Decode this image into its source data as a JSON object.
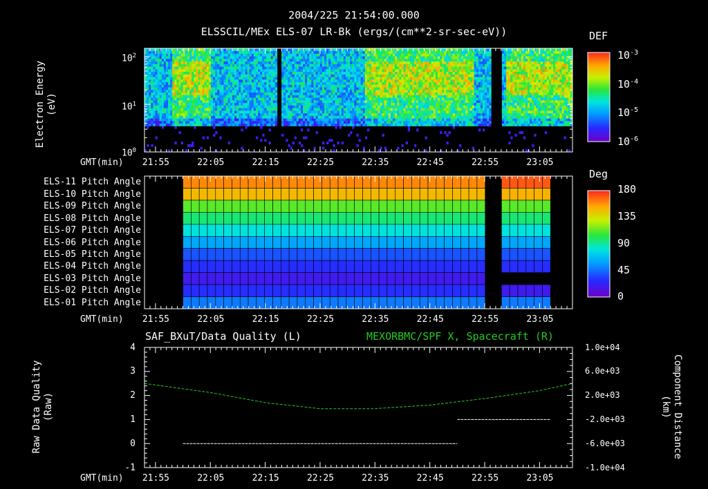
{
  "header": {
    "title": "2004/225 21:54:00.000",
    "subtitle": "ELSSCIL/MEx ELS-07 LR-Bk  (ergs/(cm**2-sr-sec-eV))"
  },
  "x_axis": {
    "label": "GMT(min)",
    "ticks": [
      "21:55",
      "22:05",
      "22:15",
      "22:25",
      "22:35",
      "22:45",
      "22:55",
      "23:05"
    ]
  },
  "panel1": {
    "ylabel_line1": "Electron Energy",
    "ylabel_line2": "(eV)",
    "yticks": [
      {
        "base": "10",
        "exp": "2"
      },
      {
        "base": "10",
        "exp": "1"
      },
      {
        "base": "10",
        "exp": "0"
      }
    ],
    "colorbar_title": "DEF",
    "colorbar_ticks": [
      {
        "base": "10",
        "exp": "-3"
      },
      {
        "base": "10",
        "exp": "-4"
      },
      {
        "base": "10",
        "exp": "-5"
      },
      {
        "base": "10",
        "exp": "-6"
      }
    ]
  },
  "panel2": {
    "rows": [
      "ELS-11 Pitch Angle",
      "ELS-10 Pitch Angle",
      "ELS-09 Pitch Angle",
      "ELS-08 Pitch Angle",
      "ELS-07 Pitch Angle",
      "ELS-06 Pitch Angle",
      "ELS-05 Pitch Angle",
      "ELS-04 Pitch Angle",
      "ELS-03 Pitch Angle",
      "ELS-02 Pitch Angle",
      "ELS-01 Pitch Angle"
    ],
    "colorbar_title": "Deg",
    "colorbar_ticks": [
      "180",
      "135",
      "90",
      "45",
      "0"
    ]
  },
  "panel3": {
    "left_title": "SAF_BXuT/Data Quality (L)",
    "right_title": "MEXORBMC/SPF X, Spacecraft (R)",
    "ylabel_left_line1": "Raw Data Quality",
    "ylabel_left_line2": "(Raw)",
    "ylabel_right_line1": "Component Distance",
    "ylabel_right_line2": "(km)",
    "left_ticks": [
      "4",
      "3",
      "2",
      "1",
      "0",
      "-1"
    ],
    "right_ticks": [
      "1.0e+04",
      "6.0e+03",
      "2.0e+03",
      "-2.0e+03",
      "-6.0e+03",
      "-1.0e+04"
    ],
    "colors": {
      "quality": "#ffffff",
      "position": "#22cc22"
    }
  },
  "chart_data": [
    {
      "type": "heatmap",
      "title": "ELSSCIL/MEx ELS-07 LR-Bk  (ergs/(cm**2-sr-sec-eV))",
      "xlabel": "GMT(min)",
      "ylabel": "Electron Energy (eV)",
      "x_range": [
        "21:53",
        "23:11"
      ],
      "y_range": [
        1,
        150
      ],
      "y_scale": "log",
      "colorbar": {
        "label": "DEF",
        "range": [
          1e-06,
          0.001
        ],
        "scale": "log"
      },
      "data_gaps": [
        [
          "22:17",
          "22:18"
        ],
        [
          "22:56",
          "22:58"
        ]
      ]
    },
    {
      "type": "heatmap",
      "xlabel": "GMT(min)",
      "categories": [
        "ELS-11 Pitch Angle",
        "ELS-10 Pitch Angle",
        "ELS-09 Pitch Angle",
        "ELS-08 Pitch Angle",
        "ELS-07 Pitch Angle",
        "ELS-06 Pitch Angle",
        "ELS-05 Pitch Angle",
        "ELS-04 Pitch Angle",
        "ELS-03 Pitch Angle",
        "ELS-02 Pitch Angle",
        "ELS-01 Pitch Angle"
      ],
      "pitch_angles_deg": [
        160,
        148,
        112,
        96,
        80,
        60,
        38,
        28,
        18,
        28,
        48
      ],
      "pitch_angles_after_gap_deg": [
        170,
        150,
        112,
        96,
        80,
        60,
        38,
        28,
        0,
        18,
        48
      ],
      "data_range": [
        "22:00",
        "23:07"
      ],
      "data_gap": [
        "22:56",
        "22:58"
      ],
      "colorbar": {
        "label": "Deg",
        "range": [
          0,
          180
        ]
      }
    },
    {
      "type": "line",
      "xlabel": "GMT(min)",
      "series": [
        {
          "name": "SAF_BXuT/Data Quality (L)",
          "axis": "left",
          "x": [
            "22:00",
            "22:50",
            "22:50",
            "23:07"
          ],
          "y": [
            0,
            0,
            1,
            1
          ],
          "segments": [
            {
              "x": [
                "22:00",
                "22:50"
              ],
              "y": [
                0,
                0
              ]
            },
            {
              "x": [
                "22:50",
                "23:07"
              ],
              "y": [
                1,
                1
              ]
            }
          ]
        },
        {
          "name": "MEXORBMC/SPF X, Spacecraft (R)",
          "axis": "right",
          "x": [
            "21:53",
            "22:05",
            "22:15",
            "22:25",
            "22:35",
            "22:45",
            "22:55",
            "23:05",
            "23:11"
          ],
          "y": [
            4000,
            2500,
            800,
            -200,
            -200,
            400,
            1500,
            2800,
            4000
          ]
        }
      ],
      "ylim_left": [
        -1,
        4
      ],
      "ylim_right": [
        -10000,
        10000
      ]
    }
  ]
}
